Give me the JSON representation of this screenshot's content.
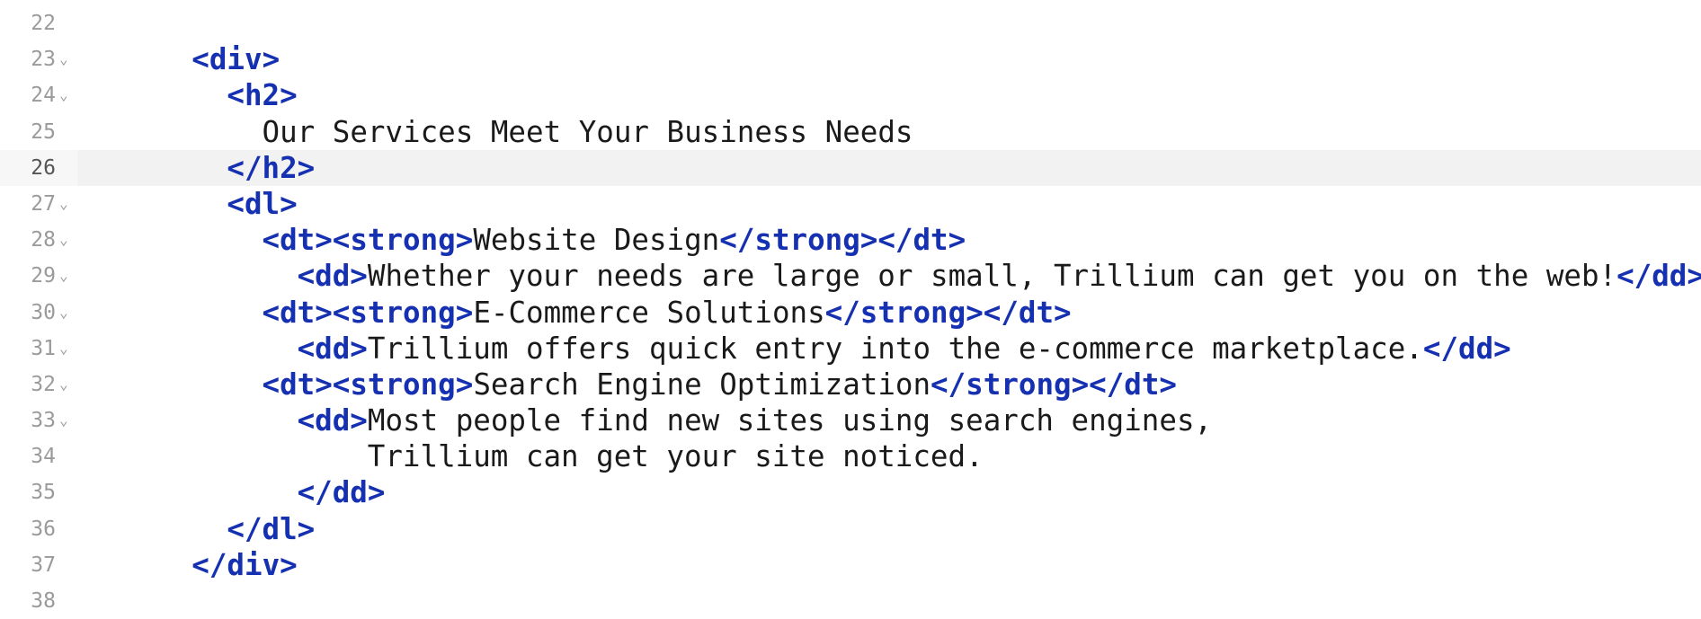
{
  "editor": {
    "lines": [
      {
        "num": "22",
        "fold": "",
        "indent": 0,
        "segments": []
      },
      {
        "num": "23",
        "fold": "⌄",
        "indent": 6,
        "segments": [
          {
            "t": "tag",
            "v": "<div>"
          }
        ]
      },
      {
        "num": "24",
        "fold": "⌄",
        "indent": 8,
        "segments": [
          {
            "t": "tag",
            "v": "<h2>"
          }
        ]
      },
      {
        "num": "25",
        "fold": "",
        "indent": 10,
        "segments": [
          {
            "t": "txt",
            "v": "Our Services Meet Your Business Needs"
          }
        ]
      },
      {
        "num": "26",
        "fold": "",
        "indent": 8,
        "current": true,
        "segments": [
          {
            "t": "tag",
            "v": "</h2>"
          }
        ]
      },
      {
        "num": "27",
        "fold": "⌄",
        "indent": 8,
        "segments": [
          {
            "t": "tag",
            "v": "<dl>"
          }
        ]
      },
      {
        "num": "28",
        "fold": "⌄",
        "indent": 10,
        "segments": [
          {
            "t": "tag",
            "v": "<dt><strong>"
          },
          {
            "t": "txt",
            "v": "Website Design"
          },
          {
            "t": "tag",
            "v": "</strong></dt>"
          }
        ]
      },
      {
        "num": "29",
        "fold": "⌄",
        "indent": 12,
        "segments": [
          {
            "t": "tag",
            "v": "<dd>"
          },
          {
            "t": "txt",
            "v": "Whether your needs are large or small, Trillium can get you on the web!"
          },
          {
            "t": "tag",
            "v": "</dd>"
          }
        ]
      },
      {
        "num": "30",
        "fold": "⌄",
        "indent": 10,
        "segments": [
          {
            "t": "tag",
            "v": "<dt><strong>"
          },
          {
            "t": "txt",
            "v": "E-Commerce Solutions"
          },
          {
            "t": "tag",
            "v": "</strong></dt>"
          }
        ]
      },
      {
        "num": "31",
        "fold": "⌄",
        "indent": 12,
        "segments": [
          {
            "t": "tag",
            "v": "<dd>"
          },
          {
            "t": "txt",
            "v": "Trillium offers quick entry into the e-commerce marketplace."
          },
          {
            "t": "tag",
            "v": "</dd>"
          }
        ]
      },
      {
        "num": "32",
        "fold": "⌄",
        "indent": 10,
        "segments": [
          {
            "t": "tag",
            "v": "<dt><strong>"
          },
          {
            "t": "txt",
            "v": "Search Engine Optimization"
          },
          {
            "t": "tag",
            "v": "</strong></dt>"
          }
        ]
      },
      {
        "num": "33",
        "fold": "⌄",
        "indent": 12,
        "segments": [
          {
            "t": "tag",
            "v": "<dd>"
          },
          {
            "t": "txt",
            "v": "Most people find new sites using search engines,"
          }
        ]
      },
      {
        "num": "34",
        "fold": "",
        "indent": 16,
        "segments": [
          {
            "t": "txt",
            "v": "Trillium can get your site noticed."
          }
        ]
      },
      {
        "num": "35",
        "fold": "",
        "indent": 12,
        "segments": [
          {
            "t": "tag",
            "v": "</dd>"
          }
        ]
      },
      {
        "num": "36",
        "fold": "",
        "indent": 8,
        "segments": [
          {
            "t": "tag",
            "v": "</dl>"
          }
        ]
      },
      {
        "num": "37",
        "fold": "",
        "indent": 6,
        "segments": [
          {
            "t": "tag",
            "v": "</div>"
          }
        ]
      },
      {
        "num": "38",
        "fold": "",
        "indent": 0,
        "segments": []
      }
    ]
  },
  "colors": {
    "tag": "#1530b0",
    "text": "#1a1a1a",
    "line_number": "#9a9a9a",
    "current_line_bg": "#f2f2f2"
  }
}
